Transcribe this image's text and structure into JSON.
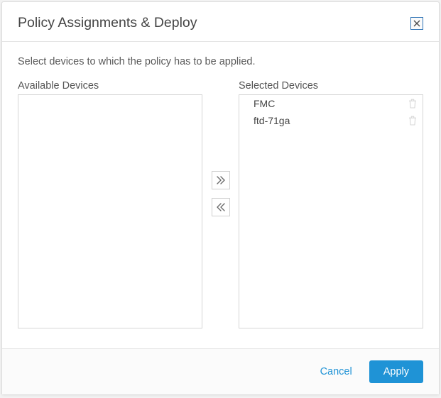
{
  "dialog": {
    "title": "Policy Assignments & Deploy",
    "close_icon_name": "close-icon"
  },
  "instruction": "Select devices to which the policy has to be applied.",
  "available": {
    "heading": "Available Devices",
    "items": []
  },
  "selected": {
    "heading": "Selected Devices",
    "items": [
      {
        "label": "FMC"
      },
      {
        "label": "ftd-71ga"
      }
    ]
  },
  "transfer": {
    "add_all_name": "add-all-button",
    "remove_all_name": "remove-all-button"
  },
  "footer": {
    "cancel": "Cancel",
    "apply": "Apply"
  }
}
